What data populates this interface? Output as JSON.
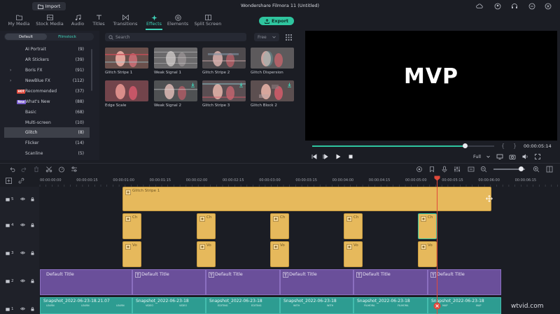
{
  "titlebar": {
    "import_label": "Import",
    "app_title": "Wondershare Filmora 11 (Untitled)"
  },
  "tabs": [
    {
      "label": "My Media",
      "icon": "folder-icon"
    },
    {
      "label": "Stock Media",
      "icon": "stock-icon"
    },
    {
      "label": "Audio",
      "icon": "music-icon"
    },
    {
      "label": "Titles",
      "icon": "titles-icon"
    },
    {
      "label": "Transitions",
      "icon": "transitions-icon"
    },
    {
      "label": "Effects",
      "icon": "effects-icon",
      "active": true
    },
    {
      "label": "Elements",
      "icon": "elements-icon"
    },
    {
      "label": "Split Screen",
      "icon": "split-screen-icon"
    }
  ],
  "export_label": "Export",
  "sidebar": {
    "seg_default": "Default",
    "seg_filmstock": "Filmstock",
    "categories": [
      {
        "name": "AI Portrait",
        "count": "(9)"
      },
      {
        "name": "AR Stickers",
        "count": "(39)"
      },
      {
        "name": "Boris FX",
        "count": "(91)",
        "expandable": true
      },
      {
        "name": "NewBlue FX",
        "count": "(112)",
        "expandable": true
      },
      {
        "name": "Recommended",
        "count": "(37)",
        "badge": "HOT"
      },
      {
        "name": "What's New",
        "count": "(88)",
        "badge": "New"
      },
      {
        "name": "Basic",
        "count": "(68)"
      },
      {
        "name": "Multi-screen",
        "count": "(10)"
      },
      {
        "name": "Glitch",
        "count": "(8)",
        "selected": true
      },
      {
        "name": "Flicker",
        "count": "(14)"
      },
      {
        "name": "Scanline",
        "count": "(5)"
      }
    ]
  },
  "effects": {
    "search_placeholder": "Search",
    "filter_value": "Free",
    "items": [
      {
        "label": "Glitch Stripe 1"
      },
      {
        "label": "Weak Signal 1"
      },
      {
        "label": "Glitch Stripe 2"
      },
      {
        "label": "Glitch Dispersion"
      },
      {
        "label": "Edge Scale"
      },
      {
        "label": "Weak Signal 2"
      },
      {
        "label": "Glitch Stripe 3"
      },
      {
        "label": "Glitch Block 2"
      }
    ]
  },
  "preview": {
    "overlay_text": "MVP",
    "timecode": "00:00:05:14",
    "quality": "Full",
    "progress_fraction": 0.84
  },
  "ruler": {
    "labels": [
      "00:00:00:00",
      "00:00:00:15",
      "00:00:01:00",
      "00:00:01:15",
      "00:00:02:00",
      "00:00:02:15",
      "00:00:03:00",
      "00:00:03:15",
      "00:00:04:00",
      "00:00:04:15",
      "00:00:05:00",
      "00:00:05:15",
      "00:00:06:00",
      "00:00:06:15"
    ]
  },
  "timeline": {
    "tracks": [
      {
        "number": "5"
      },
      {
        "number": "4"
      },
      {
        "number": "3"
      },
      {
        "number": "2"
      },
      {
        "number": "1"
      }
    ],
    "effect_clip_label": "Glitch Stripe 1",
    "small_clip_label_a": "Ch",
    "small_clip_label_b": "Vo",
    "title_clip_label": "Default Title",
    "video_clip_labels": [
      "Snapshot_2022-06-23-18.21.07",
      "Snapshot_2022-06-23-18",
      "Snapshot_2022-06-23-18",
      "Snapshot_2022-06-23-18",
      "Snapshot_2022-06-23-18",
      "Snapshot_2022-06-23-18",
      "Snapshot"
    ],
    "video_sub_labels": [
      "LEARN",
      "LEARN",
      "LEARN",
      "VIDEO",
      "VIDEO",
      "EDITING",
      "EDITING",
      "WITH",
      "WITH",
      "FILMORA",
      "FILMORA",
      "MAP",
      "MAP"
    ],
    "zoom_fraction": 0.87
  },
  "watermark": "wtvid.com",
  "colors": {
    "accent": "#3fd3b9",
    "export": "#2fc59f",
    "effect_clip": "#e6b95c",
    "title_clip": "#6a4f9a",
    "video_clip": "#2d9c91",
    "playhead": "#e0493b"
  }
}
